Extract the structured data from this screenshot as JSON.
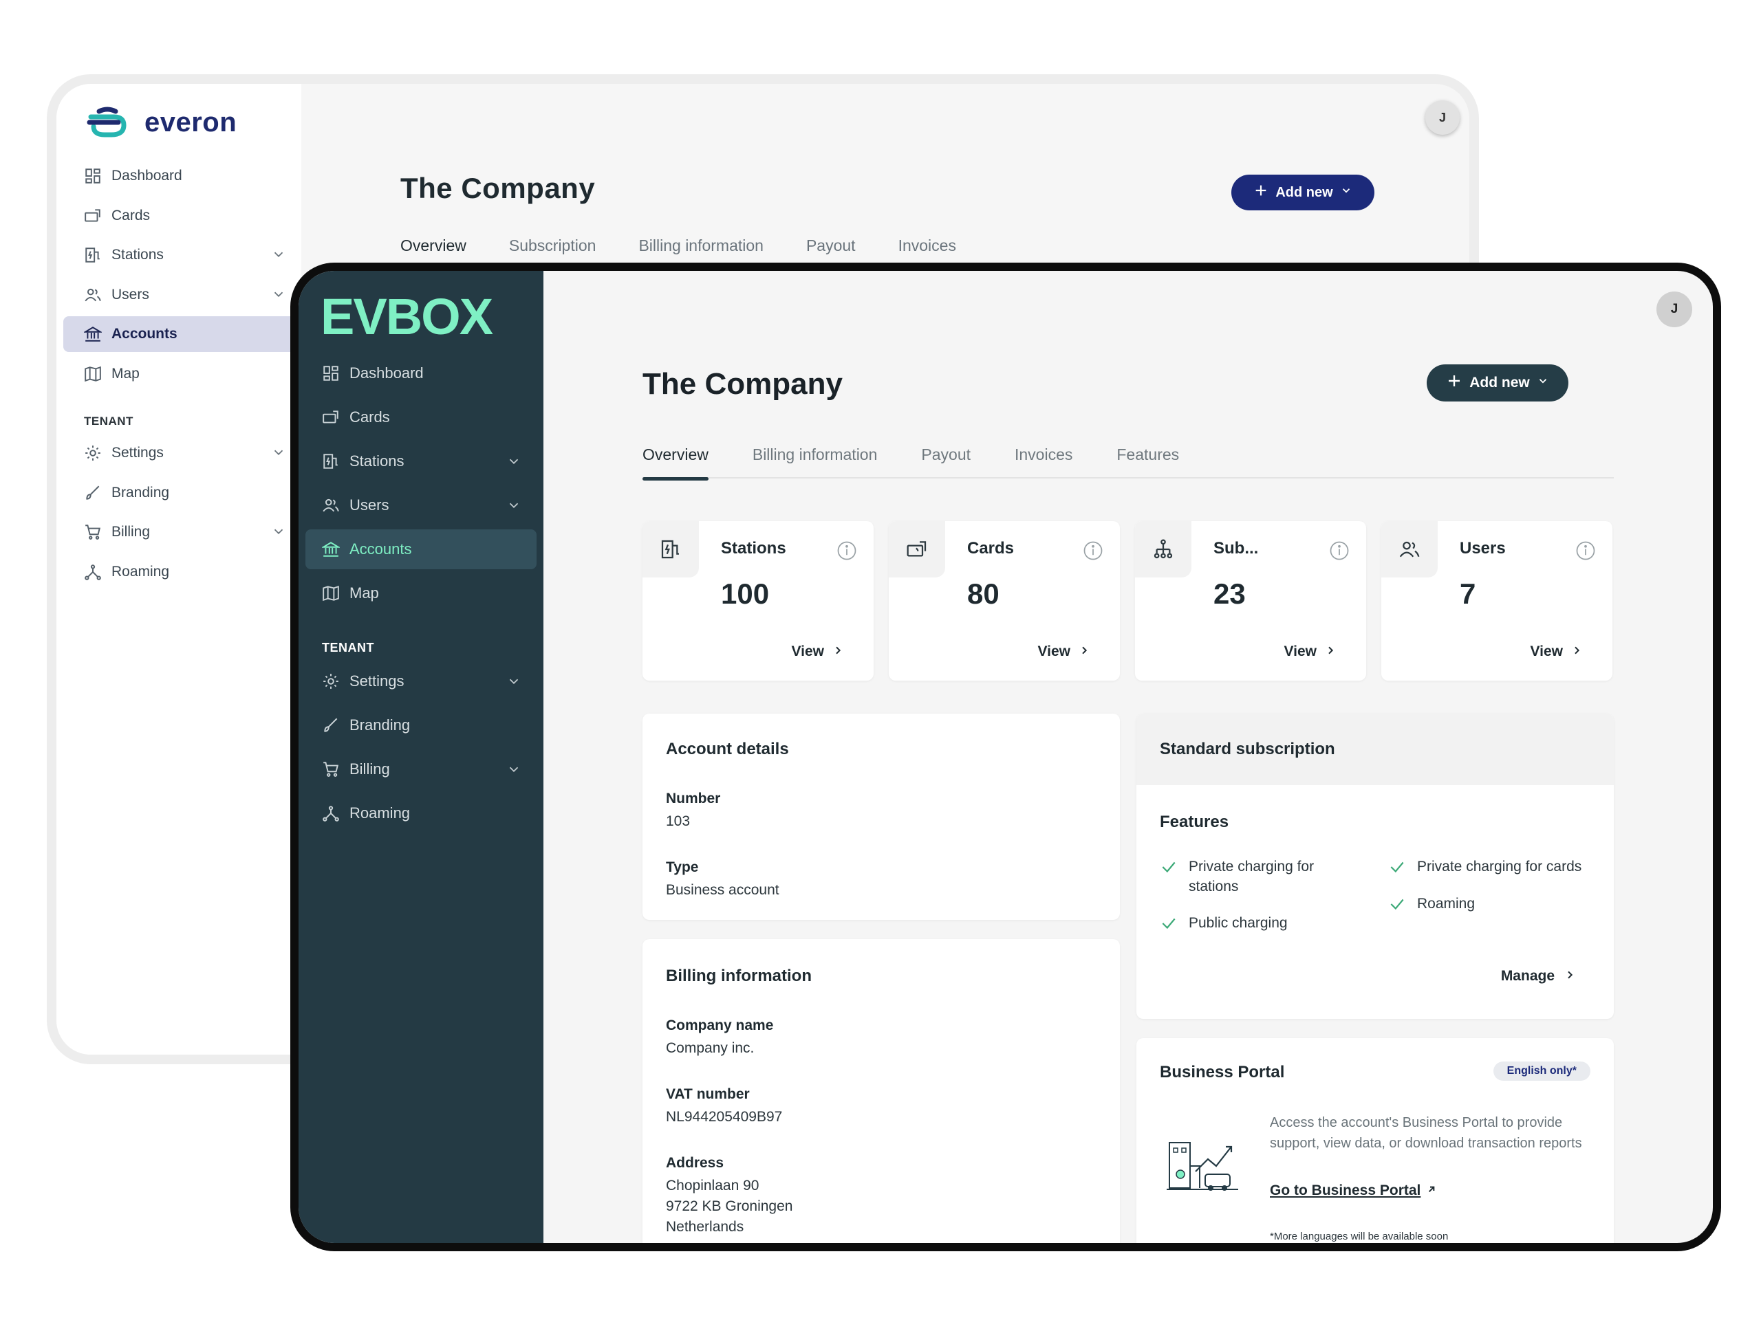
{
  "back": {
    "brand": "everon",
    "nav": [
      {
        "label": "Dashboard",
        "icon": "dashboard-icon"
      },
      {
        "label": "Cards",
        "icon": "cards-icon"
      },
      {
        "label": "Stations",
        "icon": "stations-icon",
        "expandable": true
      },
      {
        "label": "Users",
        "icon": "users-icon",
        "expandable": true
      },
      {
        "label": "Accounts",
        "icon": "accounts-icon",
        "active": true
      },
      {
        "label": "Map",
        "icon": "map-icon"
      }
    ],
    "section": "TENANT",
    "tenant_nav": [
      {
        "label": "Settings",
        "icon": "settings-icon",
        "expandable": true
      },
      {
        "label": "Branding",
        "icon": "branding-icon"
      },
      {
        "label": "Billing",
        "icon": "billing-icon",
        "expandable": true
      },
      {
        "label": "Roaming",
        "icon": "roaming-icon"
      }
    ],
    "avatar": "J",
    "title": "The Company",
    "add_new": "Add new",
    "tabs": [
      "Overview",
      "Subscription",
      "Billing information",
      "Payout",
      "Invoices"
    ],
    "accent": "#1c2a7a"
  },
  "front": {
    "brand": "EVBOX",
    "nav": [
      {
        "label": "Dashboard",
        "icon": "dashboard-icon"
      },
      {
        "label": "Cards",
        "icon": "cards-icon"
      },
      {
        "label": "Stations",
        "icon": "stations-icon",
        "expandable": true
      },
      {
        "label": "Users",
        "icon": "users-icon",
        "expandable": true
      },
      {
        "label": "Accounts",
        "icon": "accounts-icon",
        "active": true
      },
      {
        "label": "Map",
        "icon": "map-icon"
      }
    ],
    "section": "TENANT",
    "tenant_nav": [
      {
        "label": "Settings",
        "icon": "settings-icon",
        "expandable": true
      },
      {
        "label": "Branding",
        "icon": "branding-icon"
      },
      {
        "label": "Billing",
        "icon": "billing-icon",
        "expandable": true
      },
      {
        "label": "Roaming",
        "icon": "roaming-icon"
      }
    ],
    "avatar": "J",
    "title": "The Company",
    "add_new": "Add new",
    "tabs": [
      "Overview",
      "Billing information",
      "Payout",
      "Invoices",
      "Features"
    ],
    "stats": [
      {
        "label": "Stations",
        "value": "100",
        "view": "View",
        "icon": "station-icon"
      },
      {
        "label": "Cards",
        "value": "80",
        "view": "View",
        "icon": "card-icon"
      },
      {
        "label": "Sub...",
        "value": "23",
        "view": "View",
        "icon": "hierarchy-icon"
      },
      {
        "label": "Users",
        "value": "7",
        "view": "View",
        "icon": "users-icon"
      }
    ],
    "account_details": {
      "title": "Account details",
      "number_label": "Number",
      "number": "103",
      "type_label": "Type",
      "type": "Business account"
    },
    "billing": {
      "title": "Billing information",
      "company_label": "Company name",
      "company": "Company inc.",
      "vat_label": "VAT number",
      "vat": "NL944205409B97",
      "address_label": "Address",
      "address": [
        "Chopinlaan 90",
        "9722 KB Groningen",
        "Netherlands"
      ]
    },
    "subscription": {
      "title": "Standard subscription",
      "features_title": "Features",
      "features_left": [
        "Private charging for stations",
        "Public charging"
      ],
      "features_right": [
        "Private charging for cards",
        "Roaming"
      ],
      "manage": "Manage"
    },
    "portal": {
      "title": "Business Portal",
      "badge": "English only*",
      "description": "Access the account's Business Portal to provide support, view data, or download transaction reports",
      "link": "Go to Business Portal",
      "footnote": "*More languages will be available soon"
    },
    "brand_color": "#7ff0c4",
    "sidebar_color": "#243a44"
  }
}
